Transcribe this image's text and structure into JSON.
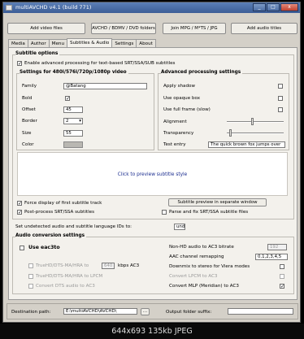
{
  "window": {
    "title": "multiAVCHD v4.1 (build 771)",
    "min": "_",
    "max": "□",
    "close": "x"
  },
  "toolbar": {
    "add_video": "Add video files",
    "avchd": "AVCHD / BDMV / DVD folders",
    "join": "Join MPG / M*TS / JPG",
    "add_audio": "Add audio titles"
  },
  "tabs": [
    "Media",
    "Author",
    "Menu",
    "Subtitles & Audio",
    "Settings",
    "About"
  ],
  "subtitle": {
    "group_label": "Subtitle options",
    "enable_label": "Enable advanced processing for text-based SRT/SSA/SUB subtitles",
    "settings_label": "Settings for 480i/576i/720p/1080p video",
    "family_label": "Family",
    "family_value": "@Batang",
    "bold_label": "Bold",
    "offset_label": "Offset",
    "offset_value": "45",
    "border_label": "Border",
    "border_value": "2",
    "size_label": "Size",
    "size_value": "55",
    "color_label": "Color",
    "adv_label": "Advanced processing settings",
    "apply_shadow": "Apply shadow",
    "use_opaque": "Use opaque box",
    "use_fullframe": "Use full frame (slow)",
    "alignment": "Alignment",
    "transparency": "Transparency",
    "test_entry": "Test entry",
    "test_value": "The quick brown fox jumps over",
    "preview_text": "Click to preview subtitle style",
    "force_display": "Force display of first subtitle track",
    "preview_window": "Subtitle preview in separate window",
    "postprocess": "Post-process SRT/SSA subtitles",
    "parsefix": "Parse and fix SRT/SSA subtitle files"
  },
  "lang": {
    "label": "Set undetected audio and subtitle language IDs to:",
    "value": "und"
  },
  "audio": {
    "group_label": "Audio conversion settings",
    "use_eac3to": "Use eac3to",
    "truehd_ac3": "TrueHD/DTS-MA/HRA to",
    "kbps_value": "640",
    "kbps_label": "kbps AC3",
    "truehd_lpcm": "TrueHD/DTS-MA/HRA to LPCM",
    "convert_dts": "Convert DTS audio to AC3",
    "nonhd_label": "Non-HD audio to AC3 bitrate",
    "nonhd_value": "192",
    "remap_label": "AAC channel remapping",
    "remap_value": "0,1,2,3,4,5",
    "downmix": "Downmix to stereo for Viera modes",
    "lpcm_ac3": "Convert LPCM to AC3",
    "mlp": "Convert MLP (Meridian) to AC3"
  },
  "dest": {
    "label": "Destination path:",
    "value": "E:\\multiAVCHD\\AVCHD\\",
    "browse": "...",
    "suffix_label": "Output folder suffix:"
  },
  "viewer_status": "644x693  135kb  JPEG"
}
